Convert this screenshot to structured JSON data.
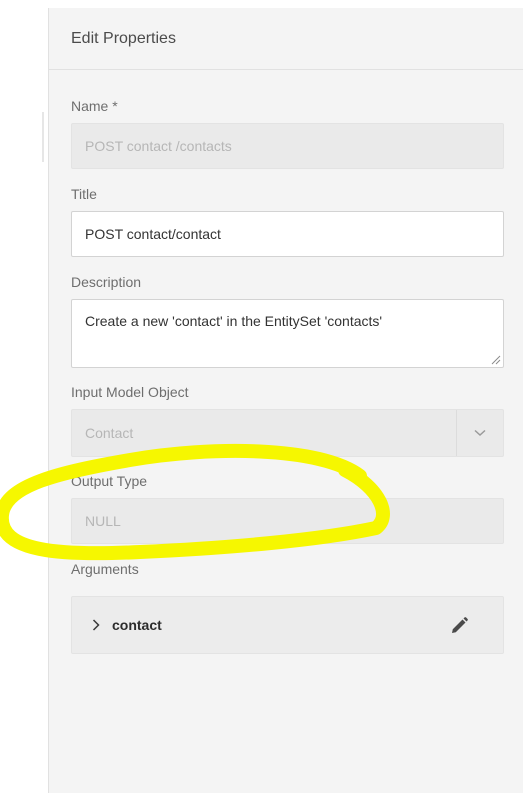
{
  "panel": {
    "title": "Edit Properties"
  },
  "fields": {
    "name": {
      "label": "Name *",
      "value": "POST contact /contacts"
    },
    "title": {
      "label": "Title",
      "value": "POST contact/contact"
    },
    "description": {
      "label": "Description",
      "value": "Create a new 'contact' in the EntitySet 'contacts'"
    },
    "input_model": {
      "label": "Input Model Object",
      "value": "Contact"
    },
    "output_type": {
      "label": "Output Type",
      "value": "NULL"
    }
  },
  "arguments": {
    "label": "Arguments",
    "items": [
      {
        "name": "contact"
      }
    ]
  },
  "icons": {
    "chevron": "chevron-down-icon",
    "expand": "chevron-right-icon",
    "edit": "pencil-icon"
  },
  "colors": {
    "highlight": "#f6f700",
    "panel_bg": "#f4f4f4",
    "disabled_field": "#eaeaea"
  }
}
